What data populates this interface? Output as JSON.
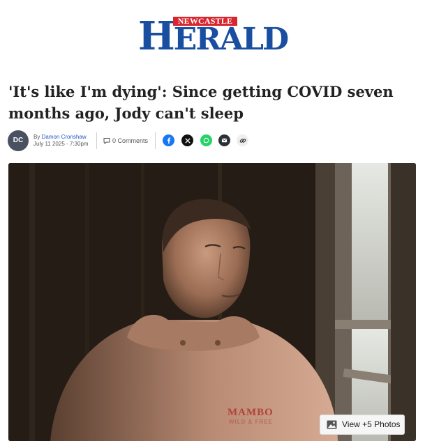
{
  "masthead": {
    "top": "NEWCASTLE",
    "initial": "H",
    "rest": "ERALD"
  },
  "article": {
    "headline": "'It's like I'm dying': Since getting COVID seven months ago, Jody can't sleep",
    "author_initials": "DC",
    "byline_prefix": "By",
    "author": "Damon Cronshaw",
    "date": "July 11 2025 - 7:30pm",
    "comments": "0 Comments",
    "hoodie_text": "MAMBO",
    "hoodie_subtext": "WILD & FREE"
  },
  "share_icons": [
    "facebook-icon",
    "x-icon",
    "whatsapp-icon",
    "email-icon",
    "link-icon"
  ],
  "gallery": {
    "button_label": "View +5 Photos"
  },
  "colors": {
    "brand_blue": "#1a4ea0",
    "brand_red": "#d8262f",
    "facebook": "#1877f2",
    "whatsapp": "#25d366"
  }
}
